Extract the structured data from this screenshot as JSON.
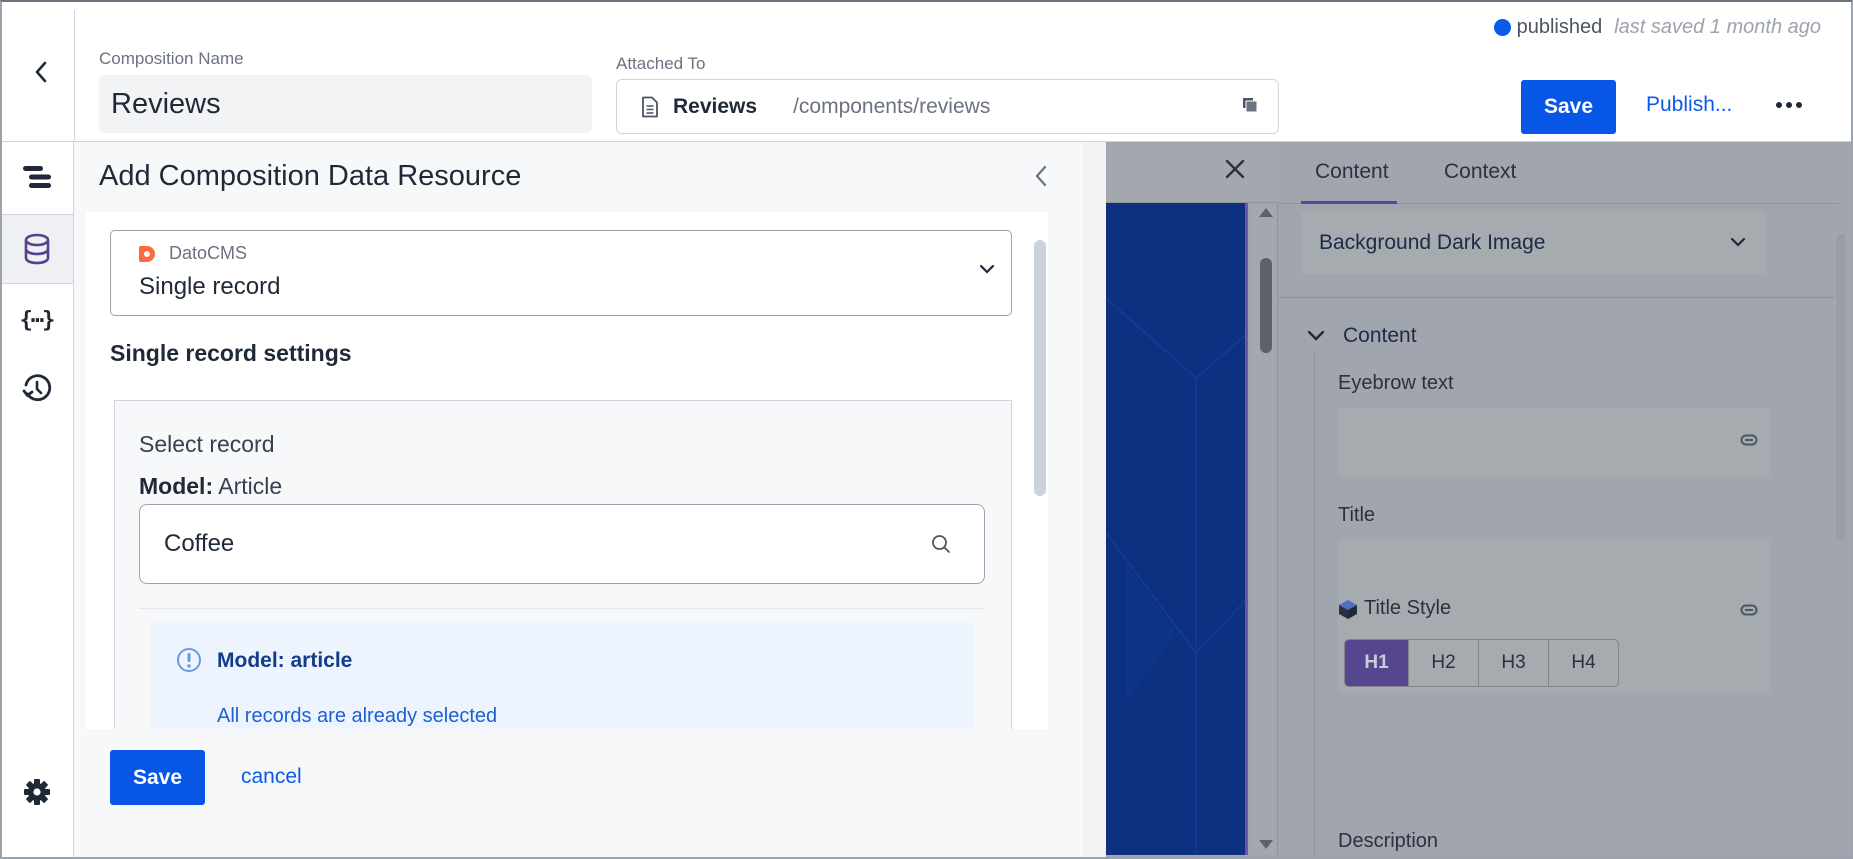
{
  "header": {
    "back_label": "Back",
    "composition_name_label": "Composition Name",
    "composition_name_value": "Reviews",
    "attached_to_label": "Attached To",
    "attached_to_name": "Reviews",
    "attached_to_path": "/components/reviews",
    "status": "published",
    "last_saved": "last saved 1 month ago",
    "save_label": "Save",
    "publish_label": "Publish...",
    "status_color": "#0b5ae8"
  },
  "rail": {
    "items": [
      {
        "icon": "structure-icon",
        "label": "Structure"
      },
      {
        "icon": "database-icon",
        "label": "Data resources",
        "active": true
      },
      {
        "icon": "braces-icon",
        "label": "{...}"
      },
      {
        "icon": "history-icon",
        "label": "History"
      }
    ],
    "settings_icon": "gear-icon"
  },
  "drawer": {
    "title": "Add Composition Data Resource",
    "source": {
      "provider": "DatoCMS",
      "value": "Single record"
    },
    "section_title": "Single record settings",
    "select_record_label": "Select record",
    "model_label": "Model:",
    "model_value": "Article",
    "search_value": "Coffee",
    "info": {
      "title": "Model: article",
      "text": "All records are already selected"
    },
    "save_label": "Save",
    "cancel_label": "cancel",
    "accent_color": "#0756e6"
  },
  "props": {
    "tabs": [
      {
        "label": "Content",
        "active": true
      },
      {
        "label": "Context",
        "active": false
      }
    ],
    "variant": "Background Dark Image",
    "group": "Content",
    "fields": {
      "eyebrow_label": "Eyebrow text",
      "eyebrow_value": "",
      "title_label": "Title",
      "title_value": "",
      "title_style_label": "Title Style",
      "title_style_options": [
        "H1",
        "H2",
        "H3",
        "H4"
      ],
      "title_style_selected": "H1",
      "description_label": "Description"
    }
  }
}
